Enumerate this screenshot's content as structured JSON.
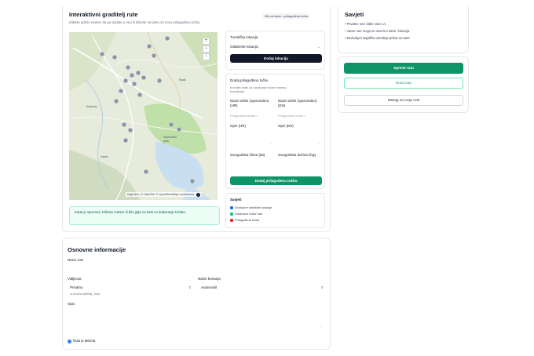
{
  "builder": {
    "title": "Interaktivni graditelj rute",
    "subtitle": "Kliknite admin marker da ga dodate u rutu ili kliknite na kartu za novu prilagođenu točku.",
    "hint_pill": "Klik na kartu = prilagođena točka",
    "map_attribution": "MapLibre | © MapTiler © OpenStreetMap contributors",
    "zoom_in": "+",
    "zoom_out": "−",
    "compass": "↑",
    "info_icon": "i",
    "ready_message": "Karta je spremna. Kliknite marker ili bilo gdje na karti za dodavanje točaka."
  },
  "tourist_location": {
    "label": "Turistička lokacija",
    "selected": "Odaberite lokaciju",
    "button": "Dodaj lokaciju"
  },
  "custom_point": {
    "heading": "Dodaj prilagođenu točku",
    "help": "Koristite kartu za dodavanje točke umjesto koordinata.",
    "name_hr_label": "Naziv točke (opcionalno) (HR)",
    "name_en_label": "Naziv točke (opcionalno) (EN)",
    "name_hr_placeholder": "Prilagođena točka 1",
    "name_en_placeholder": "Prilagođena točka 1",
    "desc_hr_label": "Opis (HR)",
    "desc_en_label": "Opis (EN)",
    "lat_label": "Geografska širina (lat)",
    "lng_label": "Geografska dužina (lng)",
    "button": "Dodaj prilagođenu točku"
  },
  "legend": {
    "title": "Savjeti",
    "items": [
      {
        "label": "Dostupne turističke lokacije",
        "color": "#2563eb"
      },
      {
        "label": "Odabrane točke rute",
        "color": "#10b981"
      },
      {
        "label": "Prilagođena točka",
        "color": "#dc2626"
      }
    ]
  },
  "tips": {
    "title": "Savjeti",
    "items": [
      "• Privatne rute vidite samo vi.",
      "• Javne rute mogu se otvoriti s karte i lokacija.",
      "• Redoslijed stajališta određuje prikaz na karti."
    ]
  },
  "actions": {
    "save": "Spremi rutu",
    "new": "Nova ruta",
    "back": "Natrag na moje rute"
  },
  "basic": {
    "title": "Osnovne informacije",
    "name_label": "Naziv rute",
    "visibility_label": "Vidljivost",
    "visibility_value": "Privatno",
    "visibility_help": "ui.routes.visibility_help",
    "travel_mode_label": "Način kretanja",
    "travel_mode_value": "Automobil",
    "description_label": "Opis",
    "active_label": "Ruta je aktivna"
  },
  "colors": {
    "primary_green": "#0f9467",
    "dark_button": "#111827",
    "info_bg": "#ecfdf5"
  }
}
